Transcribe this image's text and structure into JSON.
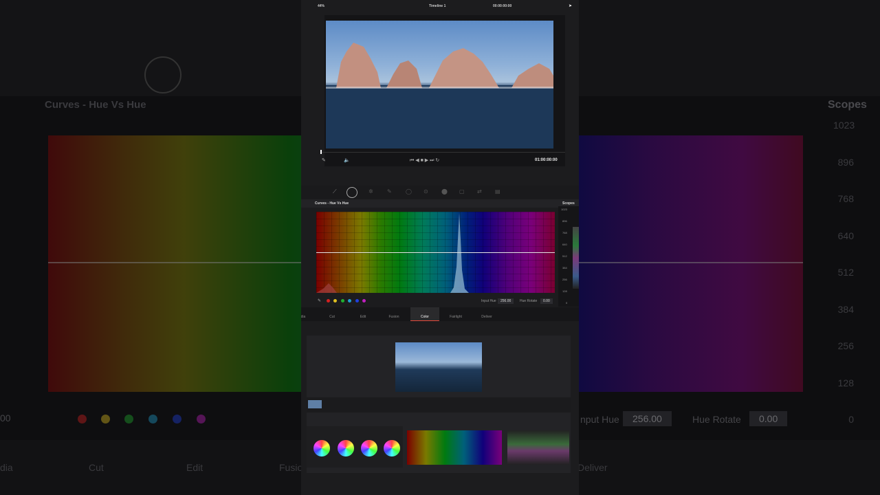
{
  "topbar": {
    "zoom": "44%",
    "timeline": "Timeline 1",
    "timecode": "00:00:00:00"
  },
  "viewer": {
    "playhead_timecode": "01:00:00:00"
  },
  "curves": {
    "title": "Curves - Hue Vs Hue",
    "scopes_label": "Scopes",
    "input_hue_label": "Input Hue",
    "input_hue_value": "256.00",
    "hue_rotate_label": "Hue Rotate",
    "hue_rotate_value": "0.00",
    "scope_ticks": [
      "1023",
      "896",
      "768",
      "640",
      "512",
      "384",
      "256",
      "128",
      "0"
    ]
  },
  "pages": {
    "tabs": [
      "dia",
      "Cut",
      "Edit",
      "Fusion",
      "Color",
      "Fairlight",
      "Deliver"
    ],
    "active": "Color"
  },
  "background": {
    "title": "Curves - Hue Vs Hue",
    "scopes": "Scopes",
    "ticks": [
      "1023",
      "896",
      "768",
      "640",
      "512",
      "384",
      "256",
      "128",
      "0"
    ],
    "input_hue_label": "nput Hue",
    "input_hue_value": "256.00",
    "hue_rotate_label": "Hue Rotate",
    "hue_rotate_value": "0.00",
    "left_value": "00",
    "tabs": [
      "dia",
      "Cut",
      "Edit",
      "Fusio",
      "Deliver"
    ]
  },
  "colors": {
    "accent": "#e64b3c",
    "dots": [
      "#d62020",
      "#e0c020",
      "#20b030",
      "#20a0d0",
      "#2040e0",
      "#c020c0"
    ]
  }
}
